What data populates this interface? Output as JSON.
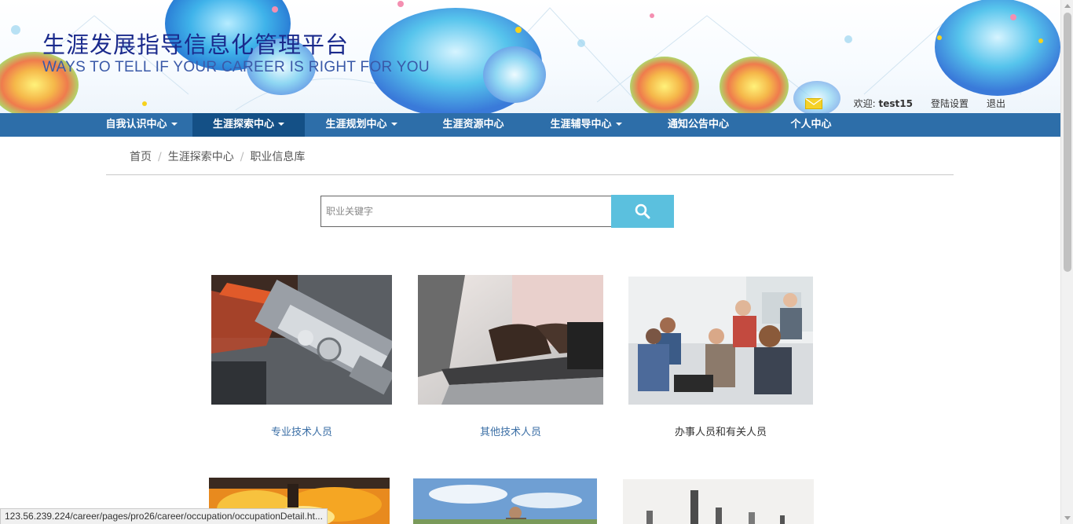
{
  "header": {
    "title": "生涯发展指导信息化管理平台",
    "subtitle": "WAYS TO TELL IF YOUR CAREER IS RIGHT FOR YOU",
    "welcome_prefix": "欢迎: ",
    "username": "test15",
    "login_settings": "登陆设置",
    "logout": "退出"
  },
  "nav": {
    "items": [
      {
        "label": "自我认识中心",
        "dropdown": true
      },
      {
        "label": "生涯探索中心",
        "dropdown": true,
        "active": true
      },
      {
        "label": "生涯规划中心",
        "dropdown": true
      },
      {
        "label": "生涯资源中心",
        "dropdown": false
      },
      {
        "label": "生涯辅导中心",
        "dropdown": true
      },
      {
        "label": "通知公告中心",
        "dropdown": false
      },
      {
        "label": "个人中心",
        "dropdown": false
      }
    ]
  },
  "breadcrumb": {
    "home": "首页",
    "section": "生涯探索中心",
    "current": "职业信息库"
  },
  "search": {
    "placeholder": "职业关键字",
    "icon": "search-icon"
  },
  "cards": [
    {
      "label": "专业技术人员",
      "image": "machinery-gears"
    },
    {
      "label": "其他技术人员",
      "image": "hands-typing-laptop"
    },
    {
      "label": "办事人员和有关人员",
      "image": "office-meeting"
    },
    {
      "label": "",
      "image": "fire-industry"
    },
    {
      "label": "",
      "image": "farm-worker-sky"
    },
    {
      "label": "",
      "image": "cutting-tools"
    }
  ],
  "status_bar": {
    "url": "123.56.239.224/career/pages/pro26/career/occupation/occupationDetail.ht..."
  },
  "colors": {
    "nav_bg": "#2d6ea9",
    "nav_active": "#145086",
    "search_button": "#5bc0de",
    "title": "#1a2a8c",
    "card_label_blue": "#3a6ea5"
  }
}
